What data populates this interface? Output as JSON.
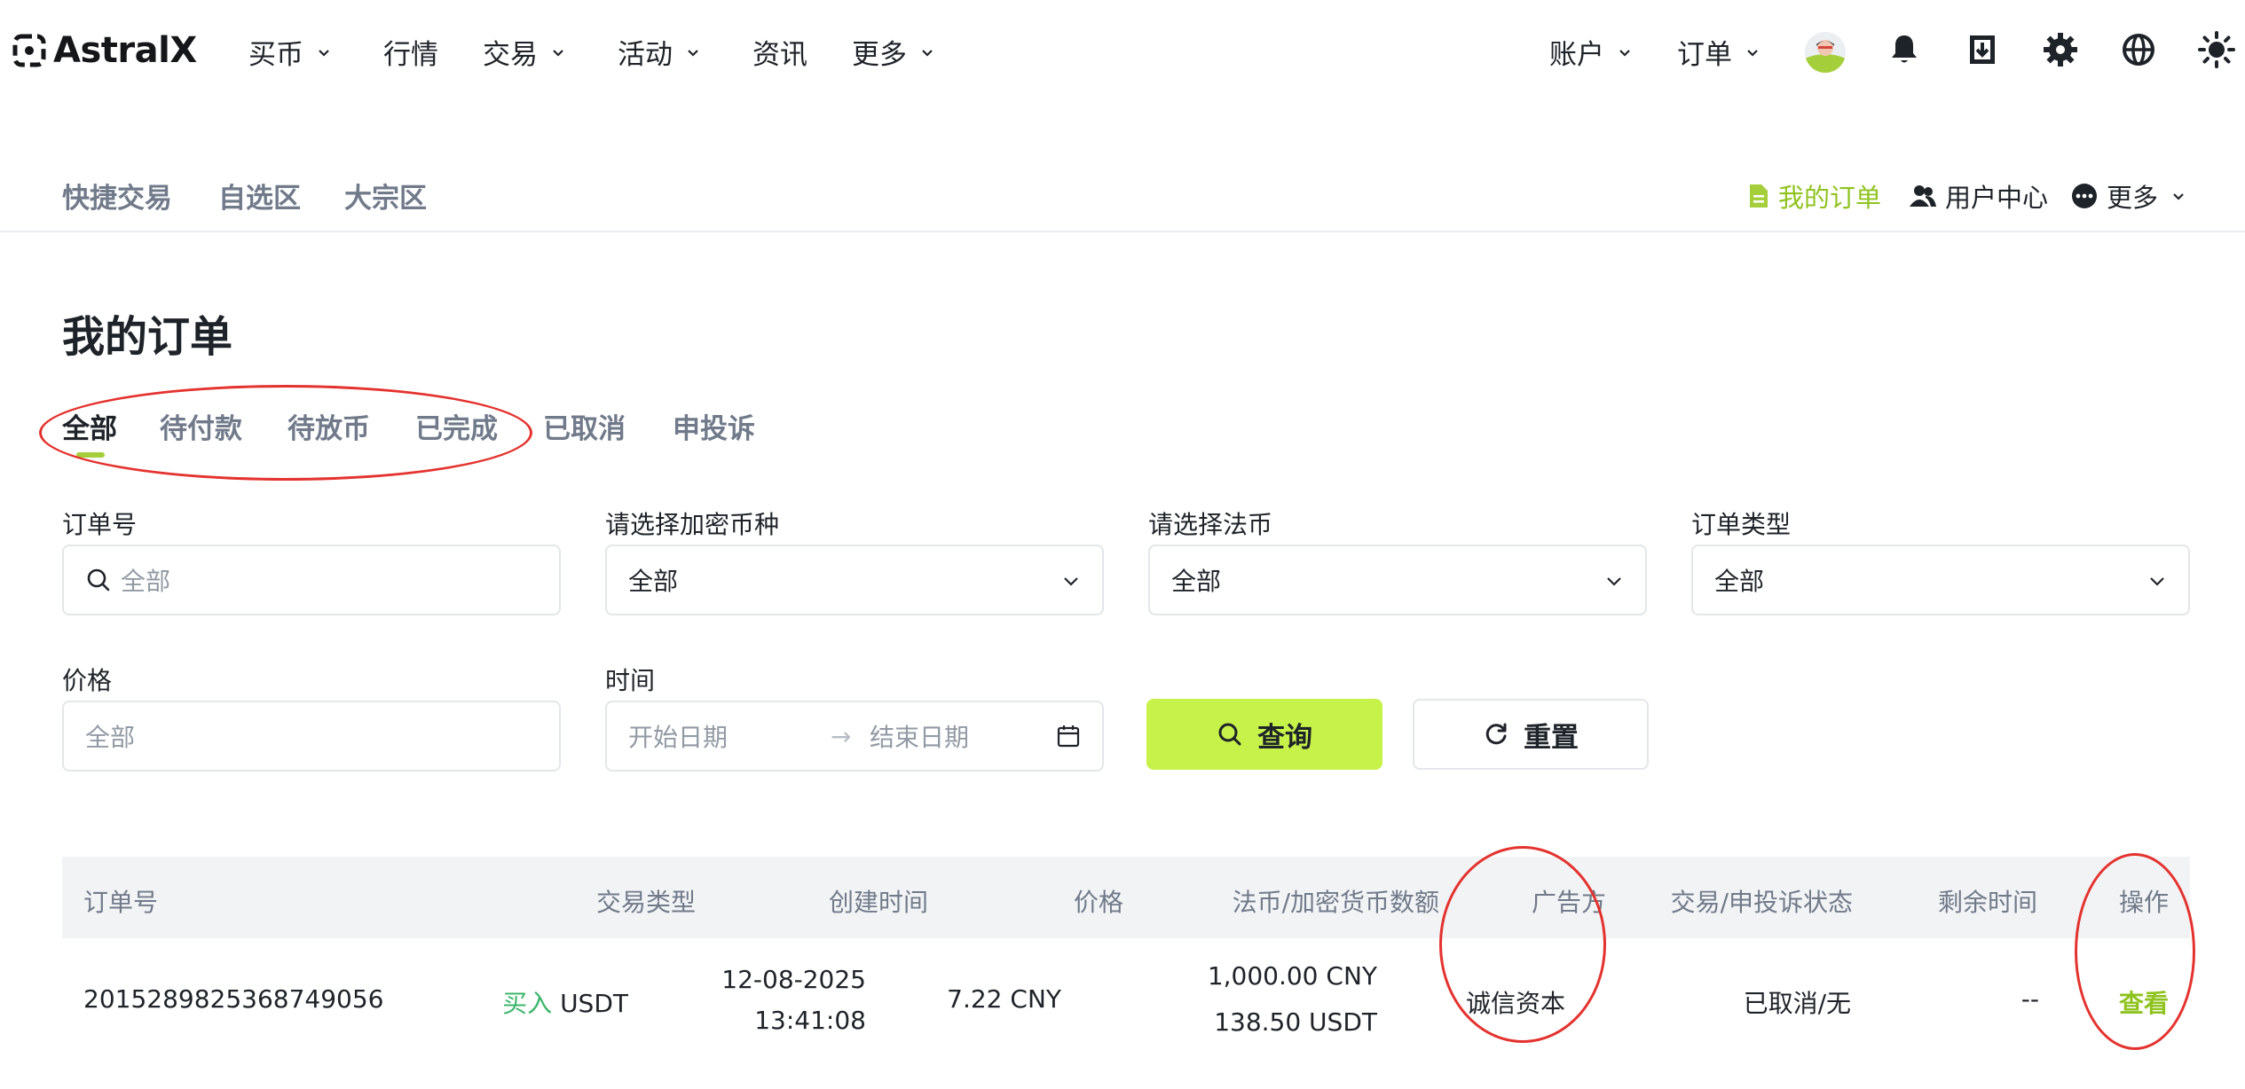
{
  "brand": {
    "name": "AstralX"
  },
  "topnav": {
    "items": [
      {
        "label": "买币",
        "dropdown": true
      },
      {
        "label": "行情",
        "dropdown": false
      },
      {
        "label": "交易",
        "dropdown": true
      },
      {
        "label": "活动",
        "dropdown": true
      },
      {
        "label": "资讯",
        "dropdown": false
      },
      {
        "label": "更多",
        "dropdown": true
      }
    ],
    "right_items": [
      {
        "label": "账户",
        "dropdown": true
      },
      {
        "label": "订单",
        "dropdown": true
      }
    ],
    "icons": [
      "avatar",
      "bell-icon",
      "download-icon",
      "gear-icon",
      "globe-icon",
      "sun-icon"
    ]
  },
  "subnav": {
    "left": [
      "快捷交易",
      "自选区",
      "大宗区"
    ],
    "right": [
      {
        "label": "我的订单",
        "icon": "document-icon",
        "active": true
      },
      {
        "label": "用户中心",
        "icon": "users-icon",
        "active": false
      },
      {
        "label": "更多",
        "icon": "more-icon",
        "active": false
      }
    ]
  },
  "page": {
    "title": "我的订单"
  },
  "tabs": [
    {
      "label": "全部",
      "active": true
    },
    {
      "label": "待付款",
      "active": false
    },
    {
      "label": "待放币",
      "active": false
    },
    {
      "label": "已完成",
      "active": false
    },
    {
      "label": "已取消",
      "active": false
    },
    {
      "label": "申投诉",
      "active": false
    }
  ],
  "filters": {
    "order_no": {
      "label": "订单号",
      "placeholder": "全部"
    },
    "crypto": {
      "label": "请选择加密币种",
      "value": "全部"
    },
    "fiat": {
      "label": "请选择法币",
      "value": "全部"
    },
    "order_type": {
      "label": "订单类型",
      "value": "全部"
    },
    "price": {
      "label": "价格",
      "placeholder": "全部"
    },
    "time": {
      "label": "时间",
      "start_placeholder": "开始日期",
      "end_placeholder": "结束日期",
      "separator": "→"
    },
    "search_label": "查询",
    "reset_label": "重置"
  },
  "table": {
    "headers": [
      "订单号",
      "交易类型",
      "创建时间",
      "价格",
      "法币/加密货币数额",
      "广告方",
      "交易/申投诉状态",
      "剩余时间",
      "操作"
    ],
    "rows": [
      {
        "order_no": "2015289825368749056",
        "side": "买入",
        "asset": "USDT",
        "date": "12-08-2025",
        "time": "13:41:08",
        "price": "7.22 CNY",
        "fiat_amount": "1,000.00 CNY",
        "crypto_amount": "138.50 USDT",
        "advertiser": "诚信资本",
        "status": "已取消/无",
        "remaining": "--",
        "action": "查看"
      }
    ]
  },
  "colors": {
    "accent": "#c7f24a",
    "accent_text": "#8fc31f",
    "buy_green": "#3cb66b",
    "annotation_red": "#e4322e",
    "header_bg": "#f2f3f5"
  }
}
